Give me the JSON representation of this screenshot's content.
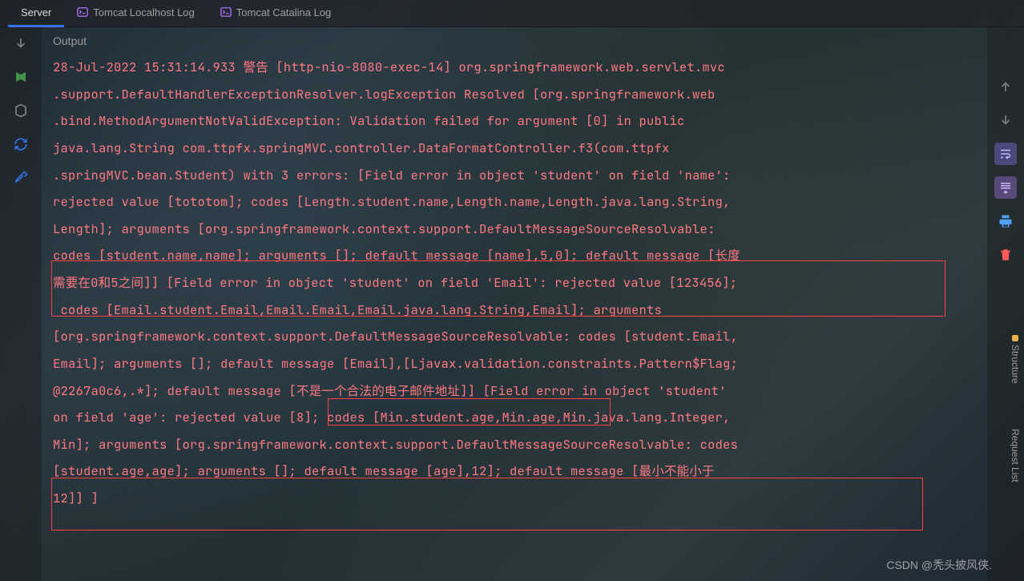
{
  "tabs": {
    "server": "Server",
    "localhost": "Tomcat Localhost Log",
    "catalina": "Tomcat Catalina Log"
  },
  "header": {
    "output": "Output"
  },
  "log": {
    "l1": "28-Jul-2022 15:31:14.933 警告 [http-nio-8080-exec-14] org.springframework.web.servlet.mvc",
    "l2": ".support.DefaultHandlerExceptionResolver.logException Resolved [org.springframework.web",
    "l3": ".bind.MethodArgumentNotValidException: Validation failed for argument [0] in public ",
    "l4": "java.lang.String com.ttpfx.springMVC.controller.DataFormatController.f3(com.ttpfx",
    "l5": ".springMVC.bean.Student) with 3 errors: [Field error in object 'student' on field 'name': ",
    "l6": "rejected value [tototom]; codes [Length.student.name,Length.name,Length.java.lang.String,",
    "l7": "Length]; arguments [org.springframework.context.support.DefaultMessageSourceResolvable: ",
    "l8": "codes [student.name,name]; arguments []; default message [name],5,0]; default message [长度",
    "l9": "需要在0和5之间]] [Field error in object 'student' on field 'Email': rejected value [123456];",
    "l10": " codes [Email.student.Email,Email.Email,Email.java.lang.String,Email]; arguments ",
    "l11": "[org.springframework.context.support.DefaultMessageSourceResolvable: codes [student.Email,",
    "l12": "Email]; arguments []; default message [Email],[Ljavax.validation.constraints.Pattern$Flag;",
    "l13": "@2267a0c6,.*]; default message [不是一个合法的电子邮件地址]] [Field error in object 'student' ",
    "l14": "on field 'age': rejected value [8]; codes [Min.student.age,Min.age,Min.java.lang.Integer,",
    "l15": "Min]; arguments [org.springframework.context.support.DefaultMessageSourceResolvable: codes ",
    "l16": "[student.age,age]; arguments []; default message [age],12]; default message [最小不能小于",
    "l17": "12]] ]"
  },
  "sideTabs": {
    "structure": "Structure",
    "request": "Request List"
  },
  "watermark": "CSDN @秃头披风侠."
}
